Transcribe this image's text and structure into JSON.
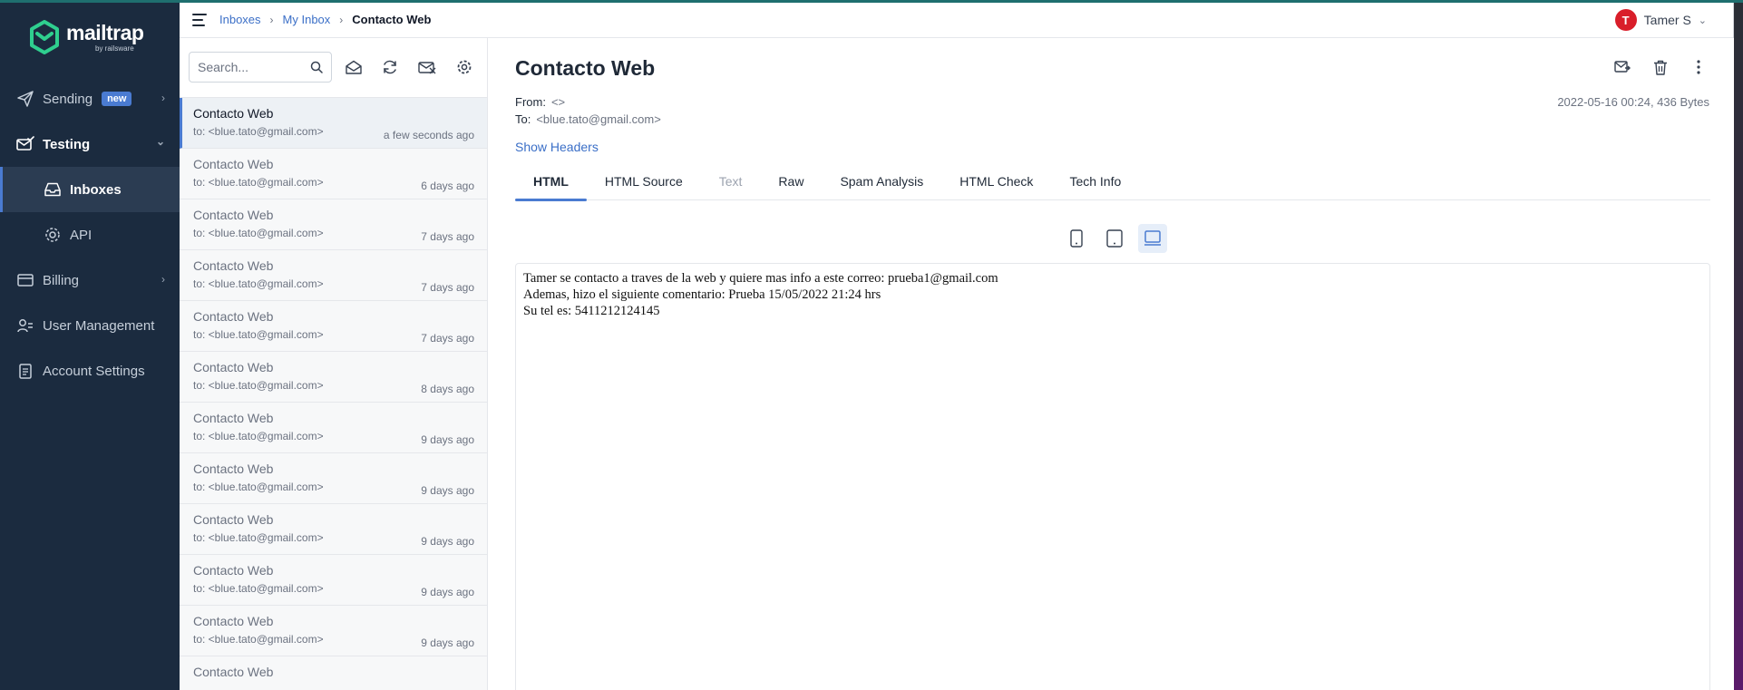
{
  "app": {
    "logo_text": "mailtrap",
    "logo_sub": "by railsware"
  },
  "sidebar": {
    "items": [
      {
        "label": "Sending",
        "icon": "send-icon",
        "badge": "new",
        "chevron": "›"
      },
      {
        "label": "Testing",
        "icon": "testing-icon",
        "chevron": "⌄"
      },
      {
        "label": "Inboxes",
        "icon": "inbox-icon"
      },
      {
        "label": "API",
        "icon": "gear-icon"
      },
      {
        "label": "Billing",
        "icon": "billing-icon",
        "chevron": "›"
      },
      {
        "label": "User Management",
        "icon": "users-icon"
      },
      {
        "label": "Account Settings",
        "icon": "document-icon"
      }
    ]
  },
  "header": {
    "breadcrumbs": [
      "Inboxes",
      "My Inbox",
      "Contacto Web"
    ],
    "separator": "›",
    "user_initial": "T",
    "user_name": "Tamer S",
    "user_chevron": "⌄"
  },
  "list": {
    "search_placeholder": "Search...",
    "messages": [
      {
        "subject": "Contacto Web",
        "to": "to: <blue.tato@gmail.com>",
        "time": "a few seconds ago"
      },
      {
        "subject": "Contacto Web",
        "to": "to: <blue.tato@gmail.com>",
        "time": "6 days ago"
      },
      {
        "subject": "Contacto Web",
        "to": "to: <blue.tato@gmail.com>",
        "time": "7 days ago"
      },
      {
        "subject": "Contacto Web",
        "to": "to: <blue.tato@gmail.com>",
        "time": "7 days ago"
      },
      {
        "subject": "Contacto Web",
        "to": "to: <blue.tato@gmail.com>",
        "time": "7 days ago"
      },
      {
        "subject": "Contacto Web",
        "to": "to: <blue.tato@gmail.com>",
        "time": "8 days ago"
      },
      {
        "subject": "Contacto Web",
        "to": "to: <blue.tato@gmail.com>",
        "time": "9 days ago"
      },
      {
        "subject": "Contacto Web",
        "to": "to: <blue.tato@gmail.com>",
        "time": "9 days ago"
      },
      {
        "subject": "Contacto Web",
        "to": "to: <blue.tato@gmail.com>",
        "time": "9 days ago"
      },
      {
        "subject": "Contacto Web",
        "to": "to: <blue.tato@gmail.com>",
        "time": "9 days ago"
      },
      {
        "subject": "Contacto Web",
        "to": "to: <blue.tato@gmail.com>",
        "time": "9 days ago"
      },
      {
        "subject": "Contacto Web",
        "to": "",
        "time": ""
      }
    ]
  },
  "message": {
    "title": "Contacto Web",
    "from_label": "From:",
    "from_value": "<>",
    "to_label": "To:",
    "to_value": "<blue.tato@gmail.com>",
    "date_size": "2022-05-16 00:24, 436 Bytes",
    "show_headers": "Show Headers",
    "tabs": [
      "HTML",
      "HTML Source",
      "Text",
      "Raw",
      "Spam Analysis",
      "HTML Check",
      "Tech Info"
    ],
    "active_tab": "HTML",
    "body_lines": [
      "Tamer se contacto a traves de la web y quiere mas info a este correo: prueba1@gmail.com",
      "Ademas, hizo el siguiente comentario: Prueba 15/05/2022 21:24 hrs",
      "Su tel es: 5411212124145"
    ]
  },
  "colors": {
    "sidebar_bg": "#1b2b3f",
    "accent": "#4a7bd1",
    "link": "#3b6fc7",
    "avatar": "#d91e2a"
  }
}
